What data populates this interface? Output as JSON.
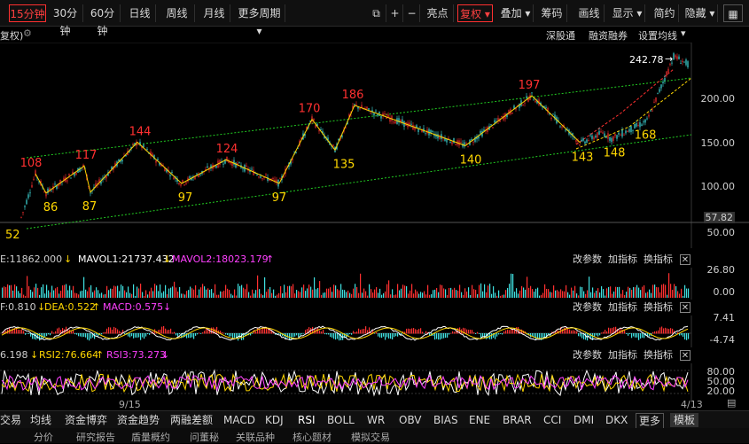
{
  "toolbar": {
    "periods": [
      "15分钟",
      "30分钟",
      "60分钟",
      "日线",
      "周线",
      "月线",
      "更多周期"
    ],
    "active_period": "15分钟",
    "tools": [
      "亮点",
      "复权",
      "叠加",
      "筹码",
      "画线",
      "显示",
      "简约",
      "隐藏"
    ],
    "active_tool": "复权"
  },
  "subbar": {
    "left_label": "复权)",
    "links": [
      "深股通",
      "融资融券",
      "设置均线"
    ]
  },
  "main": {
    "price_labels": [
      "200.00",
      "150.00",
      "100.00",
      "57.82",
      "50.00"
    ],
    "last_price_label": "57.82",
    "high_label": "242.78",
    "low_label": "52",
    "peaks": [
      {
        "text": "108"
      },
      {
        "text": "117"
      },
      {
        "text": "144"
      },
      {
        "text": "124"
      },
      {
        "text": "170"
      },
      {
        "text": "186"
      },
      {
        "text": "197"
      }
    ],
    "troughs": [
      {
        "text": "86"
      },
      {
        "text": "87"
      },
      {
        "text": "97"
      },
      {
        "text": "97"
      },
      {
        "text": "135"
      },
      {
        "text": "140"
      },
      {
        "text": "143"
      },
      {
        "text": "148"
      },
      {
        "text": "168"
      }
    ],
    "colors": {
      "up": "#ff3030",
      "down": "#40e0e0",
      "peak_label": "#ff3030",
      "trough_label": "#ffd700",
      "channel": "#22cc22"
    }
  },
  "volume": {
    "header_prefix": "E:11862.000",
    "mavol1": "MAVOL1:21737.432",
    "mavol2": "MAVOL2:18023.179",
    "axis": [
      "26.80",
      "0.00"
    ]
  },
  "macd": {
    "header_prefix": "F:0.810",
    "dea": "DEA:0.522",
    "macd": "MACD:0.575",
    "axis": [
      "7.41",
      "-4.74"
    ]
  },
  "rsi": {
    "header_prefix": "6.198",
    "rsi2": "RSI2:76.664",
    "rsi3": "RSI3:73.273",
    "axis": [
      "80.00",
      "50.00",
      "20.00"
    ]
  },
  "panel_tools": [
    "改参数",
    "加指标",
    "换指标"
  ],
  "dates": [
    "9/15",
    "4/13"
  ],
  "bottom_tabs": [
    "交易",
    "均线",
    "资金博弈",
    "资金趋势",
    "两融差额",
    "MACD",
    "KDJ",
    "RSI",
    "BOLL",
    "WR",
    "OBV",
    "BIAS",
    "ENE",
    "BRAR",
    "CCI",
    "DMI",
    "DKX",
    "更多",
    "模板"
  ],
  "active_tab": "RSI",
  "bottom_links": [
    "分价",
    "研究报告",
    "盾量概约",
    "问董秘",
    "关联品种",
    "核心题材",
    "模拟交易"
  ]
}
